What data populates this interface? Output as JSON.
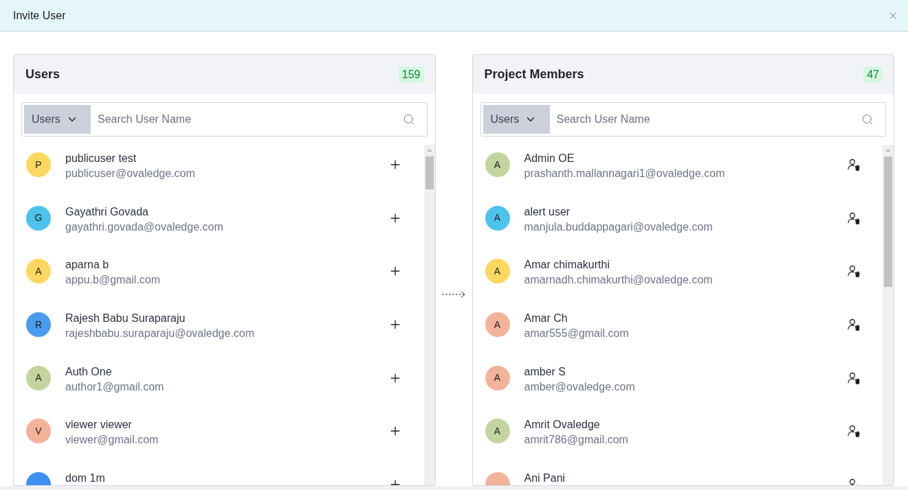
{
  "window": {
    "title": "Invite User"
  },
  "panels": [
    {
      "title": "Users",
      "count": "159",
      "filter": "Users",
      "search": {
        "placeholder": "Search User Name"
      },
      "kind": "add",
      "items": [
        {
          "initial": "P",
          "name": "publicuser test",
          "email": "publicuser@ovaledge.com",
          "color": "#fcd860"
        },
        {
          "initial": "G",
          "name": "Gayathri Govada",
          "email": "gayathri.govada@ovaledge.com",
          "color": "#4cc3ec"
        },
        {
          "initial": "A",
          "name": "aparna b",
          "email": "appu.b@gmail.com",
          "color": "#fcd860"
        },
        {
          "initial": "R",
          "name": "Rajesh Babu Suraparaju",
          "email": "rajeshbabu.suraparaju@ovaledge.com",
          "color": "#4a9cf0"
        },
        {
          "initial": "A",
          "name": "Auth One",
          "email": "author1@gmail.com",
          "color": "#c3d49e"
        },
        {
          "initial": "V",
          "name": "viewer viewer",
          "email": "viewer@gmail.com",
          "color": "#f3b29a"
        },
        {
          "name": "dom 1m",
          "color": "#3d8ff0"
        }
      ]
    },
    {
      "title": "Project Members",
      "count": "47",
      "filter": "Users",
      "search": {
        "placeholder": "Search User Name"
      },
      "kind": "remove",
      "items": [
        {
          "initial": "A",
          "name": "Admin OE",
          "email": "prashanth.mallannagari1@ovaledge.com",
          "color": "#c3d49e"
        },
        {
          "initial": "A",
          "name": "alert user",
          "email": "manjula.buddappagari@ovaledge.com",
          "color": "#4cc3ec"
        },
        {
          "initial": "A",
          "name": "Amar chimakurthi",
          "email": "amarnadh.chimakurthi@ovaledge.com",
          "color": "#fcd860"
        },
        {
          "initial": "A",
          "name": "Amar Ch",
          "email": "amar555@gmail.com",
          "color": "#f3b29a"
        },
        {
          "initial": "A",
          "name": "amber S",
          "email": "amber@ovaledge.com",
          "color": "#f3b29a"
        },
        {
          "initial": "A",
          "name": "Amrit Ovaledge",
          "email": "amrit786@gmail.com",
          "color": "#c3d49e"
        },
        {
          "name": "Ani Pani",
          "color": "#f3b29a"
        }
      ]
    }
  ]
}
